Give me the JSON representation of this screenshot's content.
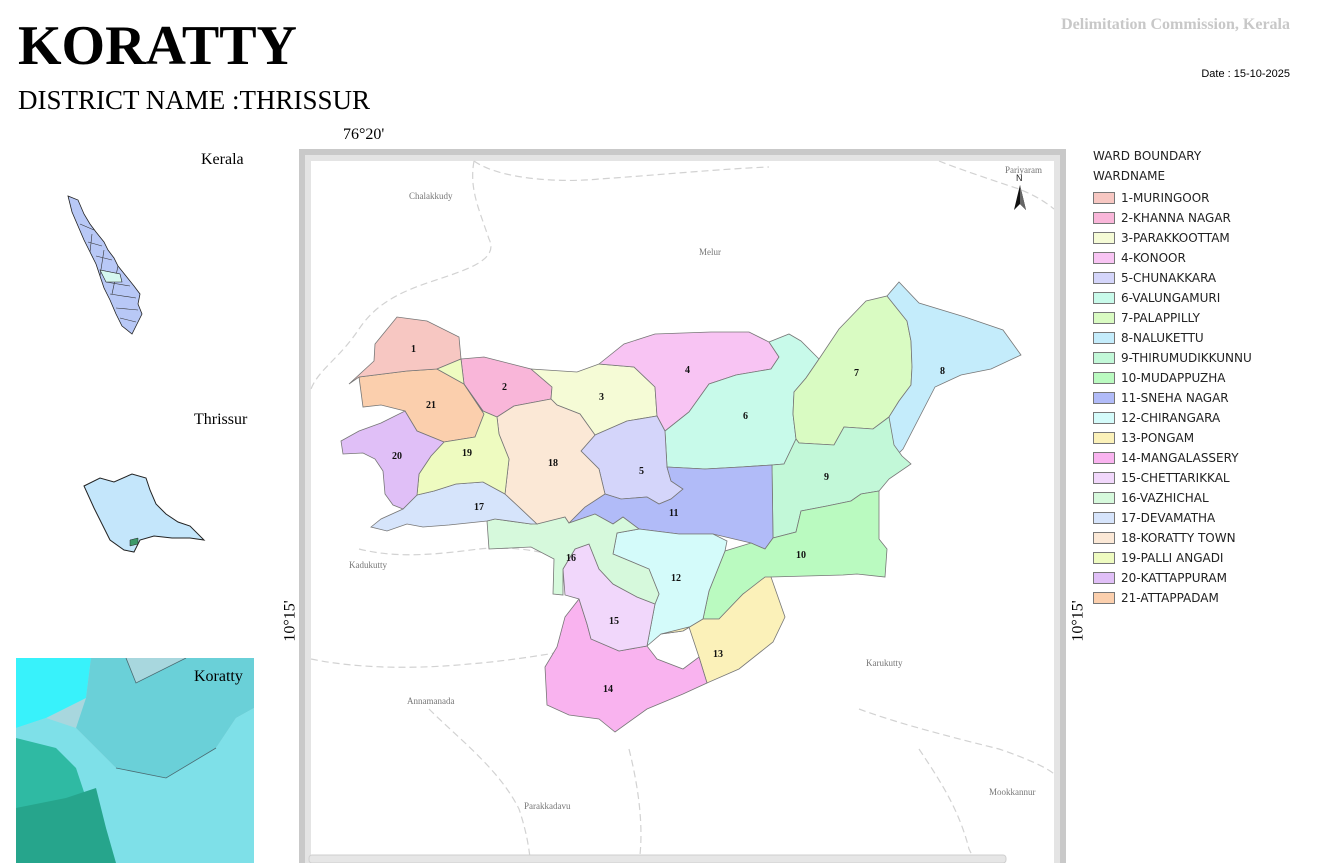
{
  "header": {
    "title": "KORATTY",
    "district": "DISTRICT NAME :THRISSUR",
    "agency": "Delimitation Commission, Kerala",
    "date": "Date : 15-10-2025"
  },
  "insets": {
    "state_label": "Kerala",
    "district_label": "Thrissur",
    "local_label": "Koratty"
  },
  "coords": {
    "top": "76°20'",
    "left": "10°15'",
    "right": "10°15'"
  },
  "map": {
    "north": "N",
    "places": [
      "Chalakkudy",
      "Melur",
      "Pariyaram",
      "Kadukutty",
      "Karukutty",
      "Annamanada",
      "Parakkadavu",
      "Mookkannur"
    ],
    "wards": [
      {
        "no": "1",
        "color": "#f7c7c2"
      },
      {
        "no": "2",
        "color": "#f9b6d9"
      },
      {
        "no": "3",
        "color": "#f5fbd6"
      },
      {
        "no": "4",
        "color": "#f8c4f3"
      },
      {
        "no": "5",
        "color": "#d4d5fa"
      },
      {
        "no": "6",
        "color": "#c8faea"
      },
      {
        "no": "7",
        "color": "#d9fbc2"
      },
      {
        "no": "8",
        "color": "#c4ecfb"
      },
      {
        "no": "9",
        "color": "#c2f8d8"
      },
      {
        "no": "10",
        "color": "#bafac0"
      },
      {
        "no": "11",
        "color": "#b1bbf8"
      },
      {
        "no": "12",
        "color": "#d4fbfa"
      },
      {
        "no": "13",
        "color": "#fbf1b9"
      },
      {
        "no": "14",
        "color": "#f9b3ef"
      },
      {
        "no": "15",
        "color": "#f1d7fb"
      },
      {
        "no": "16",
        "color": "#d6f9dc"
      },
      {
        "no": "17",
        "color": "#d6e4fb"
      },
      {
        "no": "18",
        "color": "#fbe8d6"
      },
      {
        "no": "19",
        "color": "#eefbc0"
      },
      {
        "no": "20",
        "color": "#e0bff7"
      },
      {
        "no": "21",
        "color": "#fbcfad"
      }
    ]
  },
  "legend": {
    "heading": "WARD BOUNDARY",
    "subheading": "WARDNAME",
    "items": [
      {
        "label": "1-MURINGOOR",
        "color": "#f7c7c2"
      },
      {
        "label": "2-KHANNA NAGAR",
        "color": "#f9b6d9"
      },
      {
        "label": "3-PARAKKOOTTAM",
        "color": "#f5fbd6"
      },
      {
        "label": "4-KONOOR",
        "color": "#f8c4f3"
      },
      {
        "label": "5-CHUNAKKARA",
        "color": "#d4d5fa"
      },
      {
        "label": "6-VALUNGAMURI",
        "color": "#c8faea"
      },
      {
        "label": "7-PALAPPILLY",
        "color": "#d9fbc2"
      },
      {
        "label": "8-NALUKETTU",
        "color": "#c4ecfb"
      },
      {
        "label": "9-THIRUMUDIKKUNNU",
        "color": "#c2f8d8"
      },
      {
        "label": "10-MUDAPPUZHA",
        "color": "#bafac0"
      },
      {
        "label": "11-SNEHA NAGAR",
        "color": "#b1bbf8"
      },
      {
        "label": "12-CHIRANGARA",
        "color": "#d4fbfa"
      },
      {
        "label": "13-PONGAM",
        "color": "#fbf1b9"
      },
      {
        "label": "14-MANGALASSERY",
        "color": "#f9b3ef"
      },
      {
        "label": "15-CHETTARIKKAL",
        "color": "#f1d7fb"
      },
      {
        "label": "16-VAZHICHAL",
        "color": "#d6f9dc"
      },
      {
        "label": "17-DEVAMATHA",
        "color": "#d6e4fb"
      },
      {
        "label": "18-KORATTY TOWN",
        "color": "#fbe8d6"
      },
      {
        "label": "19-PALLI ANGADI",
        "color": "#eefbc0"
      },
      {
        "label": "20-KATTAPPURAM",
        "color": "#e0bff7"
      },
      {
        "label": "21-ATTAPPADAM",
        "color": "#fbcfad"
      }
    ]
  }
}
